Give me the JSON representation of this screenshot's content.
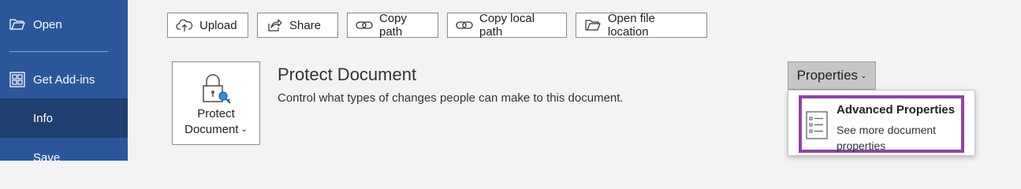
{
  "sidebar": {
    "items": [
      {
        "label": "Open",
        "icon": "folder-open-icon"
      },
      {
        "label": "Get Add-ins",
        "icon": "add-ins-icon"
      },
      {
        "label": "Info",
        "selected": true
      },
      {
        "label": "Save"
      }
    ]
  },
  "toolbar": {
    "upload": "Upload",
    "share": "Share",
    "copy_path": "Copy path",
    "copy_local_path": "Copy local path",
    "open_file_location": "Open file location"
  },
  "protect": {
    "button_line1": "Protect",
    "button_line2": "Document",
    "title": "Protect Document",
    "description": "Control what types of changes people can make to this document."
  },
  "properties": {
    "button_label": "Properties",
    "menu": {
      "title": "Advanced Properties",
      "description": "See more document properties"
    }
  },
  "colors": {
    "sidebar_bg": "#2b579a",
    "sidebar_selected": "#1e3f6f",
    "highlight_border": "#8e44a3"
  }
}
